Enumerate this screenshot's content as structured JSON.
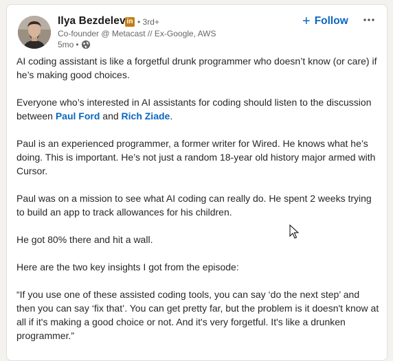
{
  "post": {
    "author": {
      "name": "Ilya Bezdelev",
      "badge": "in",
      "degree": "• 3rd+",
      "headline": "Co-founder @ Metacast // Ex-Google, AWS",
      "time": "5mo",
      "time_sep": "•",
      "visibility_icon": "globe-icon"
    },
    "actions": {
      "follow_label": "Follow",
      "follow_icon": "+",
      "more_icon": "more-icon"
    },
    "paragraphs": {
      "p1": "AI coding assistant is like a forgetful drunk programmer who doesn’t know (or care) if he’s making good choices.",
      "p2_before": "Everyone who’s interested in AI assistants for coding should listen to the discussion between ",
      "p2_link1": "Paul Ford",
      "p2_mid": " and ",
      "p2_link2": "Rich Ziade",
      "p2_after": ".",
      "p3": "Paul is an experienced programmer, a former writer for Wired. He knows what he’s doing. This is important. He’s not just a random 18-year old history major armed with Cursor.",
      "p4": "Paul was on a mission to see what AI coding can really do. He spent 2 weeks trying to build an app to track allowances for his children.",
      "p5": "He got 80% there and hit a wall.",
      "p6": "Here are the two key insights I got from the episode:",
      "p7": "“If you use one of these assisted coding tools, you can say ‘do the next step’ and then you can say ‘fix that’. You can get pretty far, but the problem is it doesn't know at all if it's making a good choice or not. And it's very forgetful. It's like a drunken programmer.”"
    },
    "colors": {
      "link": "#0a66c2",
      "badge": "#c37d16",
      "text": "#262626",
      "muted": "#666666"
    }
  }
}
